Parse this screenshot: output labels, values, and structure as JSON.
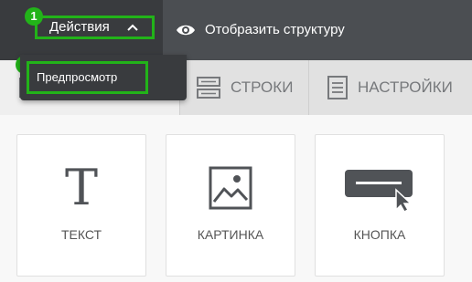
{
  "topbar": {
    "actions_label": "Действия",
    "show_structure_label": "Отобразить структуру"
  },
  "badges": {
    "one": "1",
    "two": "2"
  },
  "dropdown": {
    "preview_label": "Предпросмотр"
  },
  "tabs": {
    "rows": "СТРОКИ",
    "settings": "НАСТРОЙКИ"
  },
  "elements": [
    {
      "label": "ТЕКСТ",
      "glyph": "T",
      "icon": "text-icon"
    },
    {
      "label": "КАРТИНКА",
      "icon": "image-icon"
    },
    {
      "label": "КНОПКА",
      "icon": "button-icon"
    }
  ],
  "colors": {
    "highlight": "#22b319",
    "topbar": "#4b4e52",
    "dark_panel": "#393b3e"
  }
}
